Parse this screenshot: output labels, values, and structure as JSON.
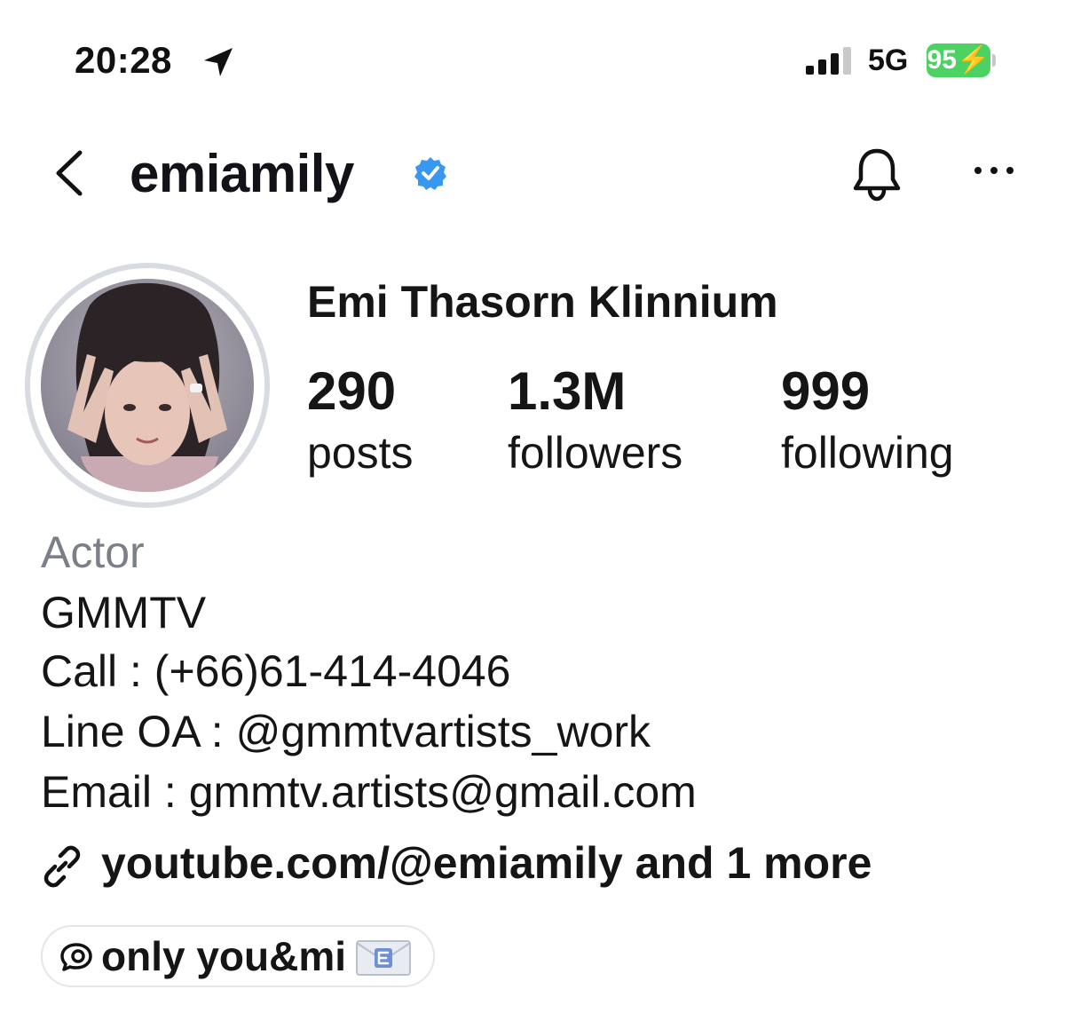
{
  "status_bar": {
    "time": "20:28",
    "network": "5G",
    "battery": "95",
    "location_icon": "location-arrow-icon",
    "signal_icon": "cellular-signal-icon"
  },
  "nav": {
    "username": "emiamily",
    "back_icon": "chevron-left-icon",
    "verified_icon": "verified-badge-icon",
    "bell_icon": "bell-icon",
    "more_icon": "more-horizontal-icon"
  },
  "profile": {
    "full_name": "Emi Thasorn Klinnium",
    "stats": [
      {
        "value": "290",
        "label": "posts"
      },
      {
        "value": "1.3M",
        "label": "followers"
      },
      {
        "value": "999",
        "label": "following"
      }
    ]
  },
  "bio": {
    "category": "Actor",
    "lines": [
      "GMMTV",
      "Call : (+66)61-414-4046",
      "Line OA : @gmmtvartists_work",
      "Email : gmmtv.artists@gmail.com"
    ],
    "link": "youtube.com/@emiamily and 1 more"
  },
  "threads": {
    "label": "only you&mi"
  },
  "colors": {
    "verified": "#3897f0",
    "battery": "#4bd262",
    "category_text": "#7a7f88",
    "ring": "#d8dbe2"
  }
}
